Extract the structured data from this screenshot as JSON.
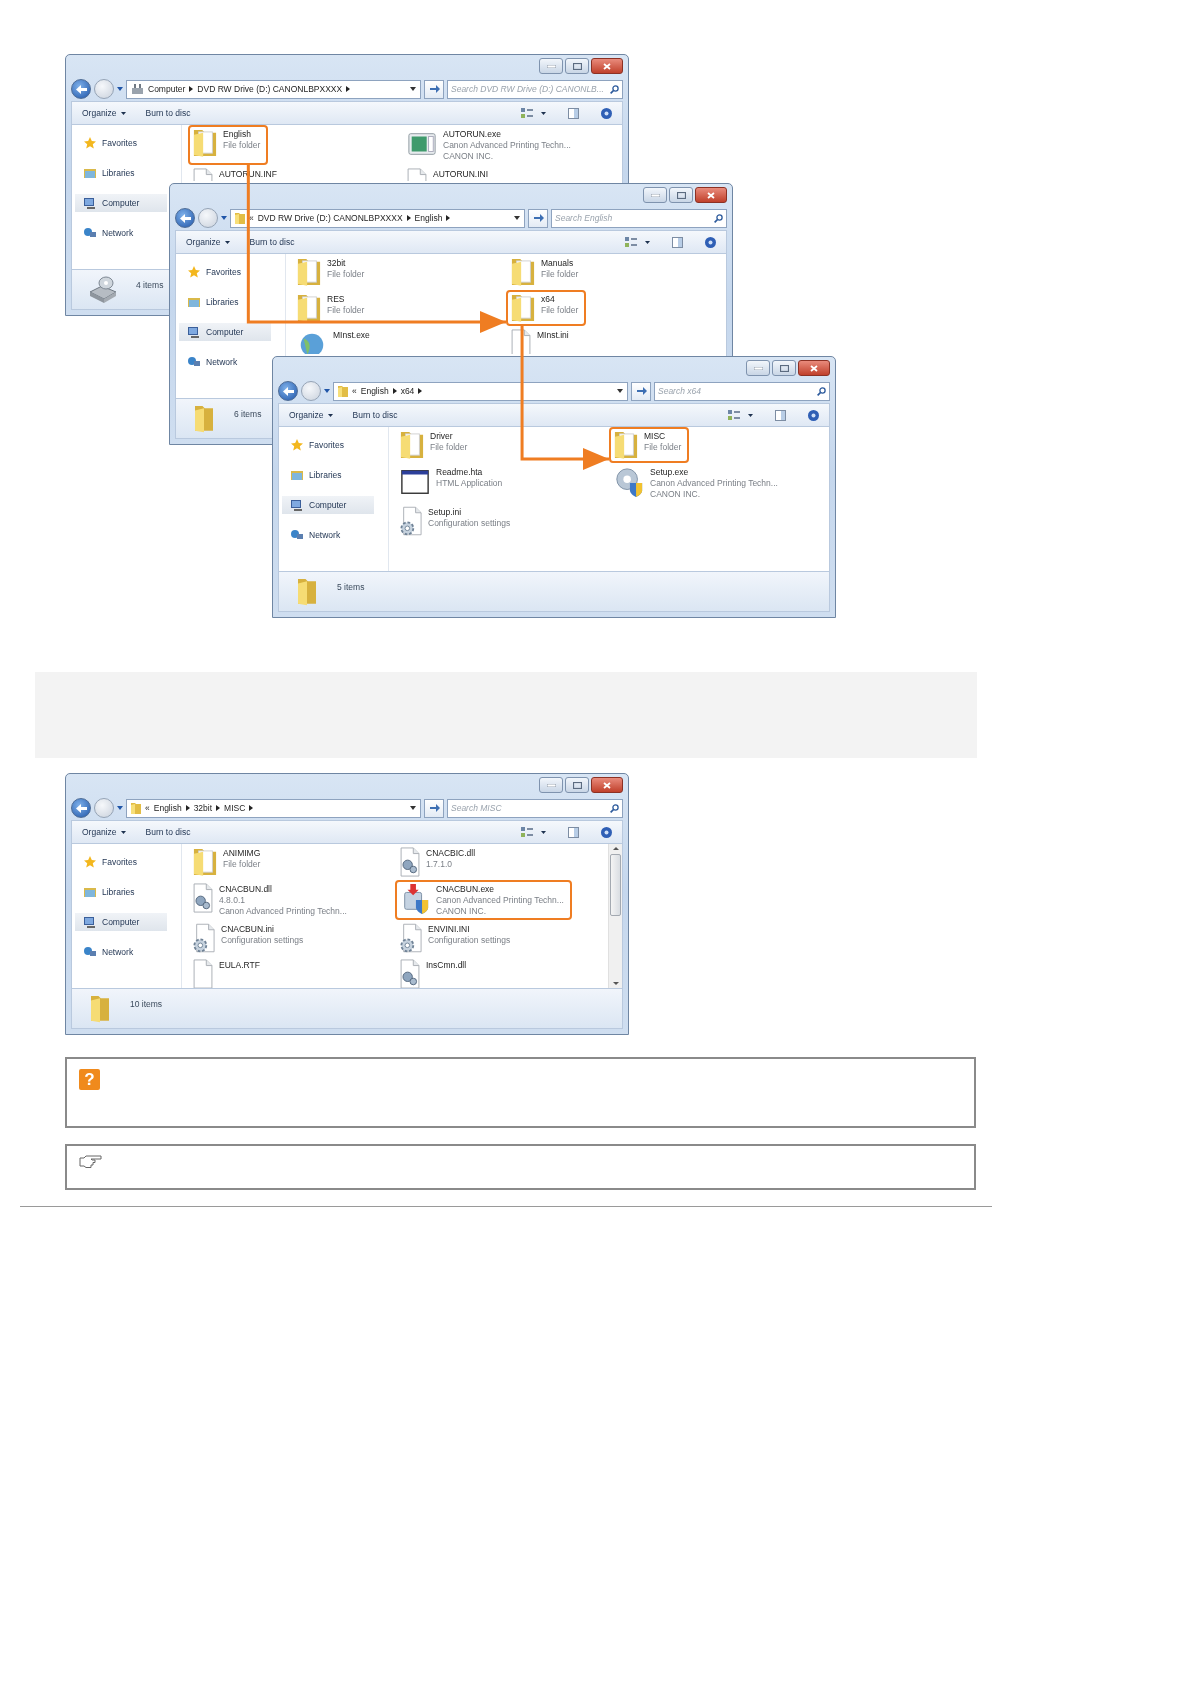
{
  "figure_1": {
    "connect_highlights": true,
    "windows": [
      {
        "address": {
          "kind": "drive",
          "segments": [
            "Computer",
            "DVD RW Drive (D:) CANONLBPXXXX"
          ]
        },
        "search_placeholder": "Search DVD RW Drive (D:) CANONLB...",
        "toolbar": [
          {
            "label": "Organize",
            "menu": true
          },
          {
            "label": "Burn to disc",
            "menu": false
          }
        ],
        "sidebar": [
          {
            "label": "Favorites",
            "kind": "favorites",
            "selected": false
          },
          {
            "label": "Libraries",
            "kind": "libraries",
            "selected": false
          },
          {
            "label": "Computer",
            "kind": "computer",
            "selected": true
          },
          {
            "label": "Network",
            "kind": "network",
            "selected": false
          }
        ],
        "items": [
          {
            "name": "English",
            "lines": [
              "File folder"
            ],
            "kind": "folder",
            "highlighted": true
          },
          {
            "name": "AUTORUN.exe",
            "lines": [
              "Canon Advanced Printing Techn...",
              "CANON INC."
            ],
            "kind": "app",
            "highlighted": false
          },
          {
            "name": "AUTORUN.INF",
            "kind": "document",
            "highlighted": false
          },
          {
            "name": "AUTORUN.INI",
            "kind": "document",
            "highlighted": false
          }
        ],
        "status": {
          "kind": "drive",
          "text": "4 items"
        }
      },
      {
        "address": {
          "kind": "folder",
          "overflow": "«",
          "segments": [
            "DVD RW Drive (D:) CANONLBPXXXX",
            "English"
          ]
        },
        "search_placeholder": "Search English",
        "toolbar": [
          {
            "label": "Organize",
            "menu": true
          },
          {
            "label": "Burn to disc",
            "menu": false
          }
        ],
        "sidebar": [
          {
            "label": "Favorites",
            "kind": "favorites",
            "selected": false
          },
          {
            "label": "Libraries",
            "kind": "libraries",
            "selected": false
          },
          {
            "label": "Computer",
            "kind": "computer",
            "selected": true
          },
          {
            "label": "Network",
            "kind": "network",
            "selected": false
          }
        ],
        "items": [
          {
            "name": "32bit",
            "lines": [
              "File folder"
            ],
            "kind": "folder",
            "highlighted": false
          },
          {
            "name": "Manuals",
            "lines": [
              "File folder"
            ],
            "kind": "folder",
            "highlighted": false
          },
          {
            "name": "RES",
            "lines": [
              "File folder"
            ],
            "kind": "folder",
            "highlighted": false
          },
          {
            "name": "x64",
            "lines": [
              "File folder"
            ],
            "kind": "folder",
            "highlighted": true
          },
          {
            "name": "MInst.exe",
            "kind": "web",
            "highlighted": false
          },
          {
            "name": "MInst.ini",
            "kind": "document",
            "highlighted": false
          }
        ],
        "status": {
          "kind": "folder",
          "text": "6 items"
        }
      },
      {
        "address": {
          "kind": "folder",
          "overflow": "«",
          "segments": [
            "English",
            "x64"
          ]
        },
        "search_placeholder": "Search x64",
        "toolbar": [
          {
            "label": "Organize",
            "menu": true
          },
          {
            "label": "Burn to disc",
            "menu": false
          }
        ],
        "sidebar": [
          {
            "label": "Favorites",
            "kind": "favorites",
            "selected": false
          },
          {
            "label": "Libraries",
            "kind": "libraries",
            "selected": false
          },
          {
            "label": "Computer",
            "kind": "computer",
            "selected": true
          },
          {
            "label": "Network",
            "kind": "network",
            "selected": false
          }
        ],
        "items": [
          {
            "name": "Driver",
            "lines": [
              "File folder"
            ],
            "kind": "folder",
            "highlighted": false
          },
          {
            "name": "MISC",
            "lines": [
              "File folder"
            ],
            "kind": "folder",
            "highlighted": true
          },
          {
            "name": "Readme.hta",
            "lines": [
              "HTML Application"
            ],
            "kind": "window",
            "highlighted": false
          },
          {
            "name": "Setup.exe",
            "lines": [
              "Canon Advanced Printing Techn...",
              "CANON INC."
            ],
            "kind": "installer",
            "highlighted": false
          },
          {
            "name": "Setup.ini",
            "lines": [
              "Configuration settings"
            ],
            "kind": "settings",
            "highlighted": false
          }
        ],
        "status": {
          "kind": "folder",
          "text": "5 items"
        }
      }
    ]
  },
  "figure_2": {
    "window": {
      "address": {
        "kind": "folder",
        "overflow": "«",
        "segments": [
          "English",
          "32bit",
          "MISC"
        ]
      },
      "search_placeholder": "Search MISC",
      "toolbar": [
        {
          "label": "Organize",
          "menu": true
        },
        {
          "label": "Burn to disc",
          "menu": false
        }
      ],
      "sidebar": [
        {
          "label": "Favorites",
          "kind": "favorites",
          "selected": false
        },
        {
          "label": "Libraries",
          "kind": "libraries",
          "selected": false
        },
        {
          "label": "Computer",
          "kind": "computer",
          "selected": true
        },
        {
          "label": "Network",
          "kind": "network",
          "selected": false
        }
      ],
      "items": [
        {
          "name": "ANIMIMG",
          "lines": [
            "File folder"
          ],
          "kind": "folder",
          "highlighted": false
        },
        {
          "name": "CNACBIC.dll",
          "lines": [
            "1.7.1.0"
          ],
          "kind": "dll",
          "highlighted": false
        },
        {
          "name": "CNACBUN.dll",
          "lines": [
            "4.8.0.1",
            "Canon Advanced Printing Techn..."
          ],
          "kind": "dll",
          "highlighted": false
        },
        {
          "name": "CNACBUN.exe",
          "lines": [
            "Canon Advanced Printing Techn...",
            "CANON INC."
          ],
          "kind": "package",
          "highlighted": true
        },
        {
          "name": "CNACBUN.ini",
          "lines": [
            "Configuration settings"
          ],
          "kind": "settings",
          "highlighted": false
        },
        {
          "name": "ENVINI.INI",
          "lines": [
            "Configuration settings"
          ],
          "kind": "settings",
          "highlighted": false
        },
        {
          "name": "EULA.RTF",
          "kind": "document",
          "highlighted": false
        },
        {
          "name": "InsCmn.dll",
          "kind": "dll",
          "highlighted": false
        }
      ],
      "scrollable": true,
      "status": {
        "kind": "folder",
        "text": "10 items"
      }
    }
  },
  "notes": [
    {
      "kind": "help",
      "badge": "?"
    },
    {
      "kind": "memo"
    }
  ]
}
